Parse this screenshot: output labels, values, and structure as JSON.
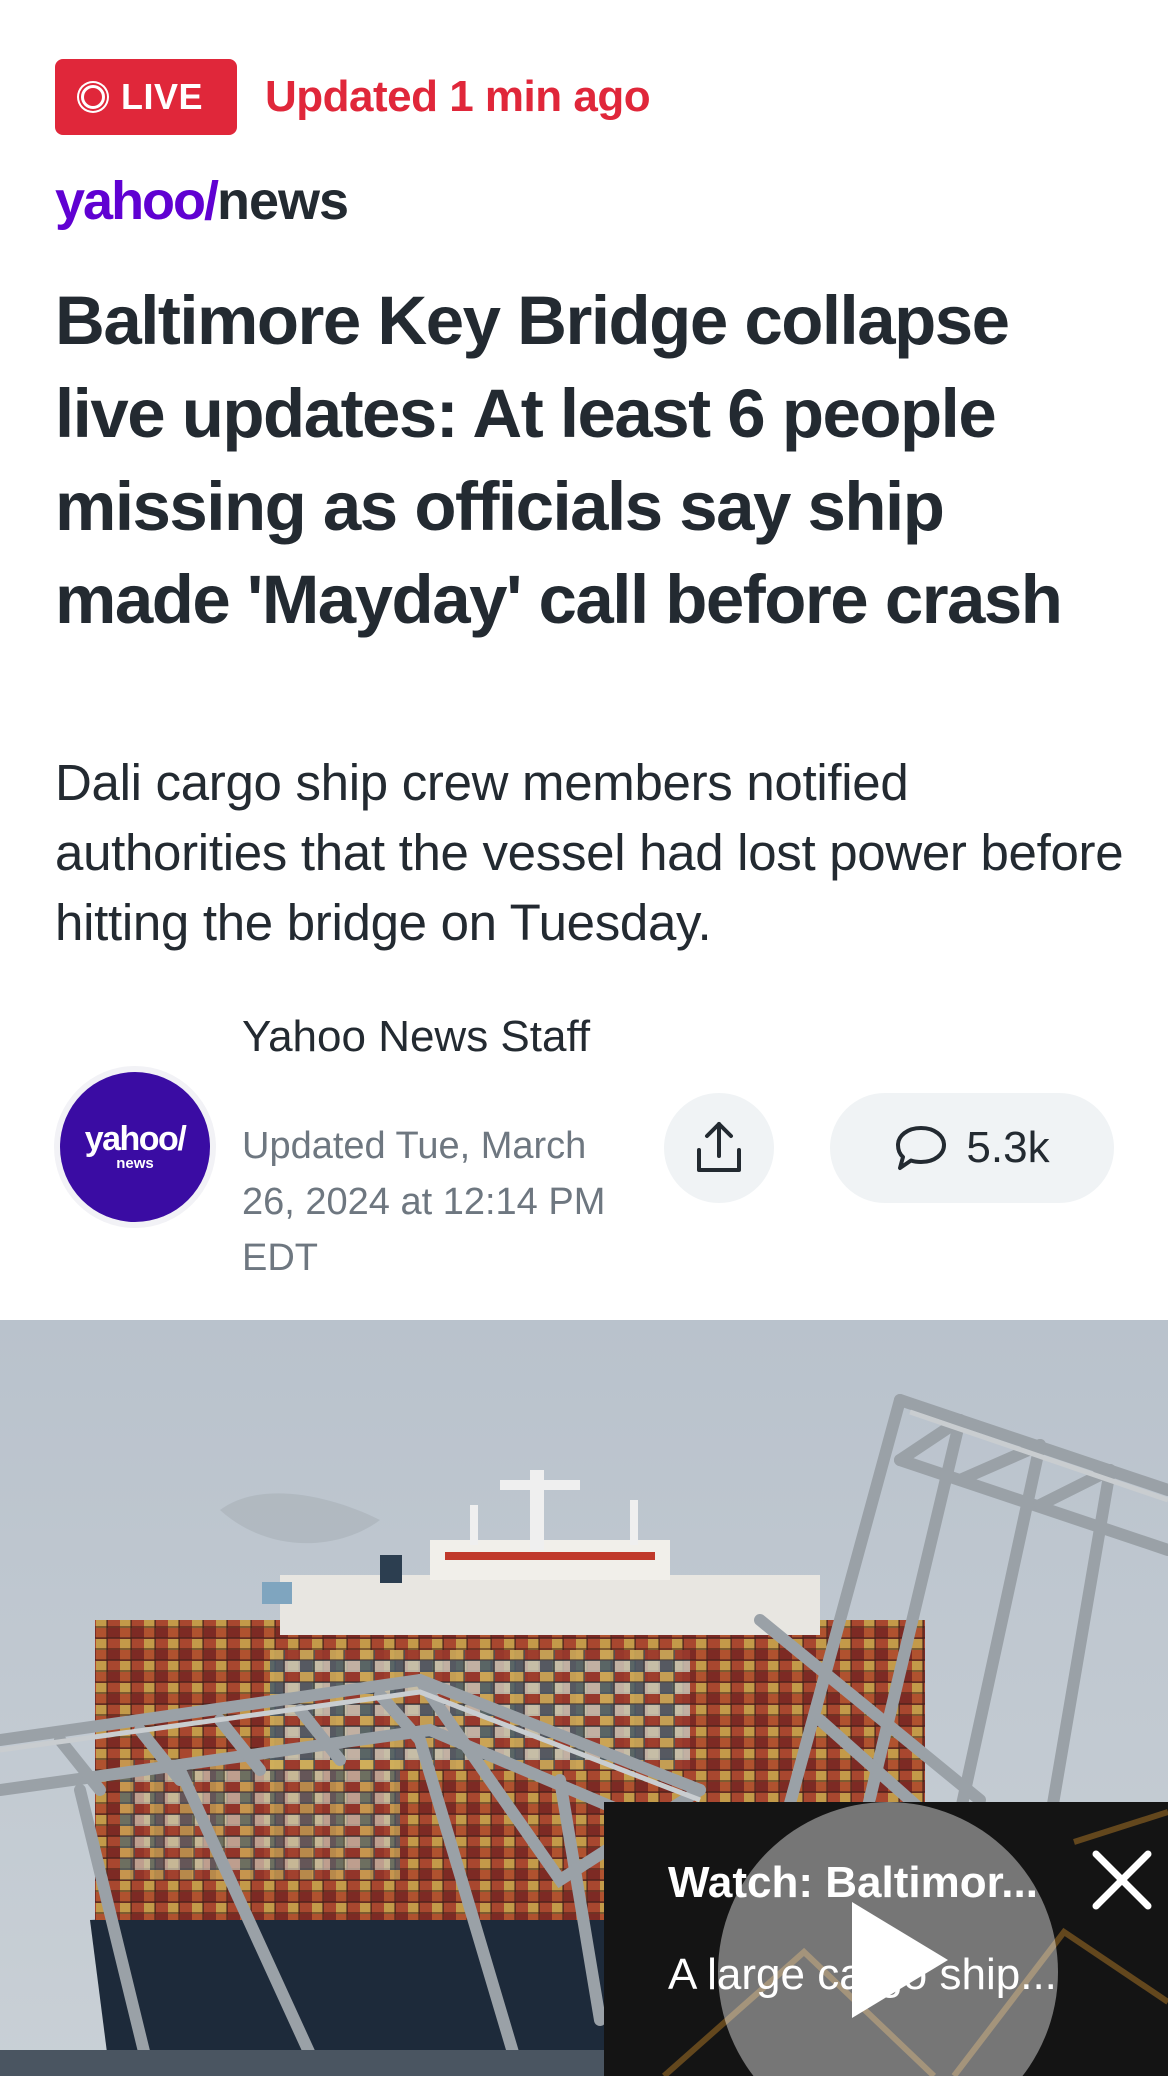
{
  "status": {
    "live_label": "LIVE",
    "updated": "Updated 1 min ago",
    "accent_color": "#e0273a"
  },
  "brand": {
    "yahoo": "yahoo/",
    "news": "news",
    "color": "#6001d2"
  },
  "article": {
    "headline": "Baltimore Key Bridge collapse live updates: At least 6 people missing as officials say ship made 'Mayday' call before crash",
    "subheadline": "Dali cargo ship crew members notified authorities that the vessel had lost power before hitting the bridge on Tuesday."
  },
  "byline": {
    "avatar_yahoo": "yahoo/",
    "avatar_news": "news",
    "author": "Yahoo News Staff",
    "updated": "Updated Tue, March 26, 2024 at 12:14 PM EDT"
  },
  "actions": {
    "share_icon": "share-icon",
    "comment_icon": "comment-icon",
    "comment_count": "5.3k"
  },
  "hero": {
    "description_icon": "photo"
  },
  "video": {
    "title": "Watch: Baltimor...",
    "description": "A large cargo ship...",
    "play_icon": "play-icon",
    "close_icon": "close-icon"
  }
}
